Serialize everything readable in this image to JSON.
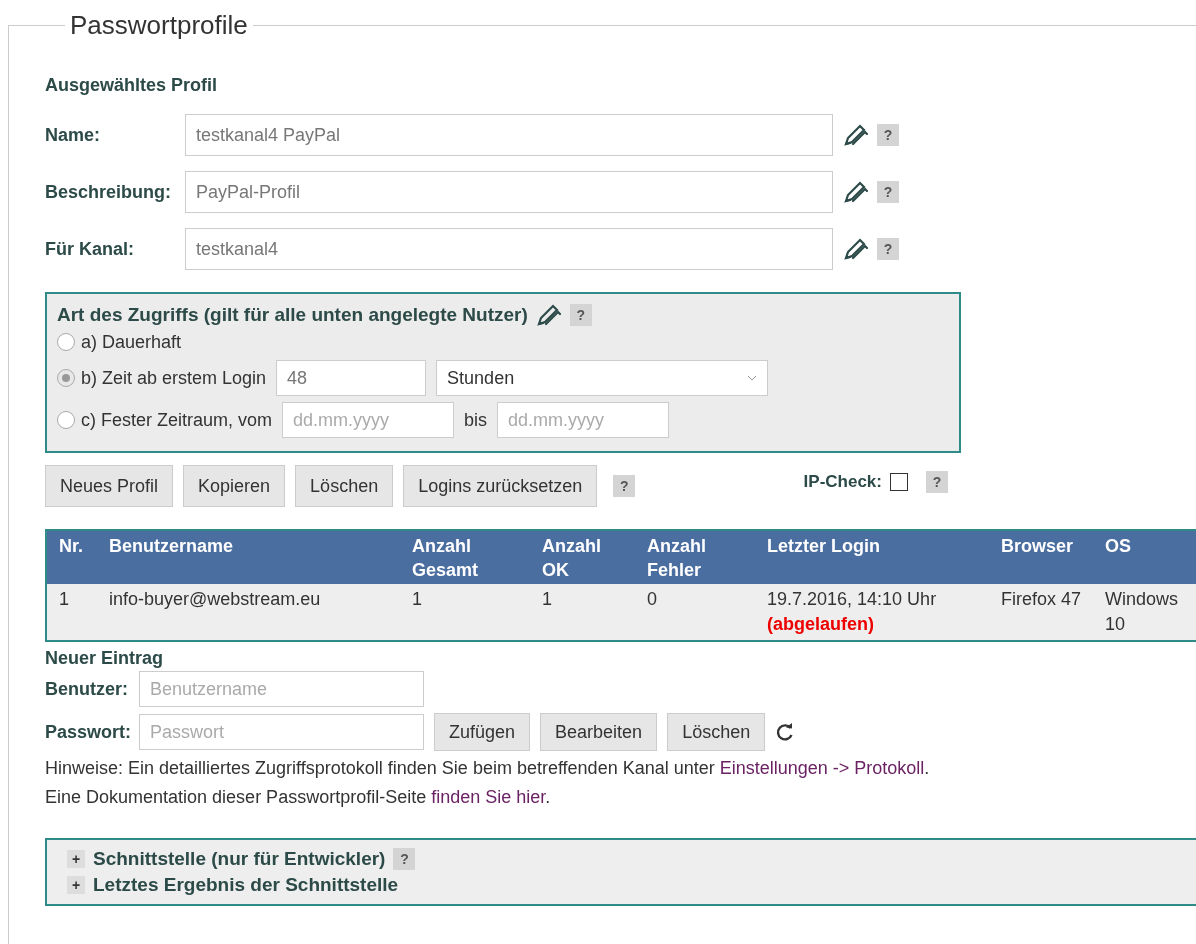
{
  "legend": "Passwortprofile",
  "profile": {
    "heading": "Ausgewähltes Profil",
    "fields": [
      {
        "label": "Name:",
        "value": "testkanal4 PayPal",
        "help": "?"
      },
      {
        "label": "Beschreibung:",
        "value": "PayPal-Profil",
        "help": "?"
      },
      {
        "label": "Für Kanal:",
        "value": "testkanal4",
        "help": "?"
      }
    ]
  },
  "access": {
    "title": "Art des Zugriffs (gilt für alle unten angelegte Nutzer)",
    "help": "?",
    "options": [
      {
        "kind": "plain",
        "label": "a) Dauerhaft",
        "selected": false
      },
      {
        "kind": "duration",
        "label": "b) Zeit ab erstem Login",
        "selected": true,
        "value": "48",
        "unit": "Stunden"
      },
      {
        "kind": "range",
        "label": "c) Fester Zeitraum, vom",
        "selected": false,
        "from_placeholder": "dd.mm.yyyy",
        "to_label": "bis",
        "to_placeholder": "dd.mm.yyyy"
      }
    ]
  },
  "profile_buttons": [
    "Neues Profil",
    "Kopieren",
    "Löschen",
    "Logins zurücksetzen"
  ],
  "profile_buttons_help": "?",
  "ip_check": {
    "label": "IP-Check:",
    "checked": false,
    "help": "?"
  },
  "users_table": {
    "columns": [
      "Nr.",
      "Benutzername",
      "Anzahl Gesamt",
      "Anzahl OK",
      "Anzahl Fehler",
      "Letzter Login",
      "Browser",
      "OS"
    ],
    "rows": [
      {
        "nr": "1",
        "username": "info-buyer@webstream.eu",
        "total": "1",
        "ok": "1",
        "errors": "0",
        "last_login": "19.7.2016, 14:10 Uhr",
        "status": "(abgelaufen)",
        "browser": "Firefox 47",
        "os": "Windows 10"
      }
    ]
  },
  "new_entry": {
    "heading": "Neuer Eintrag",
    "user_label": "Benutzer:",
    "user_placeholder": "Benutzername",
    "password_label": "Passwort:",
    "password_placeholder": "Passwort",
    "buttons": [
      "Zufügen",
      "Bearbeiten",
      "Löschen"
    ]
  },
  "notes": [
    {
      "before": "Hinweise: Ein detailliertes Zugriffsprotokoll finden Sie beim betreffenden Kanal unter ",
      "link": "Einstellungen -> Protokoll",
      "after": "."
    },
    {
      "before": "Eine Dokumentation dieser Passwortprofil-Seite ",
      "link": "finden Sie hier",
      "after": "."
    }
  ],
  "sections": [
    {
      "toggle": "+",
      "title": "Schnittstelle (nur für Entwickler)",
      "help": "?"
    },
    {
      "toggle": "+",
      "title": "Letztes Ergebnis der Schnittstelle"
    }
  ]
}
